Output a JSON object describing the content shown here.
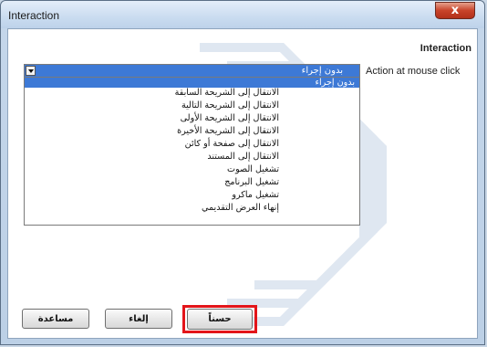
{
  "window": {
    "title": "Interaction",
    "close_glyph": "x"
  },
  "panel": {
    "heading": "Interaction",
    "action_label": "Action at mouse click"
  },
  "action_select": {
    "selected": "بدون إجراء",
    "options": [
      "بدون إجراء",
      "الانتقال إلى الشريحة السابقة",
      "الانتقال إلى الشريحة التالية",
      "الانتقال إلى الشريحة الأولى",
      "الانتقال إلى الشريحة الأخيرة",
      "الانتقال إلى صفحة أو كائن",
      "الانتقال إلى المستند",
      "تشغيل الصوت",
      "تشغيل البرنامج",
      "تشغيل ماكرو",
      "إنهاء العرض التقديمي"
    ]
  },
  "buttons": {
    "help": "مساعدة",
    "cancel": "إلغاء",
    "ok": "حسناً"
  },
  "colors": {
    "selection": "#3d79d6",
    "highlight_box": "#e3151a"
  }
}
